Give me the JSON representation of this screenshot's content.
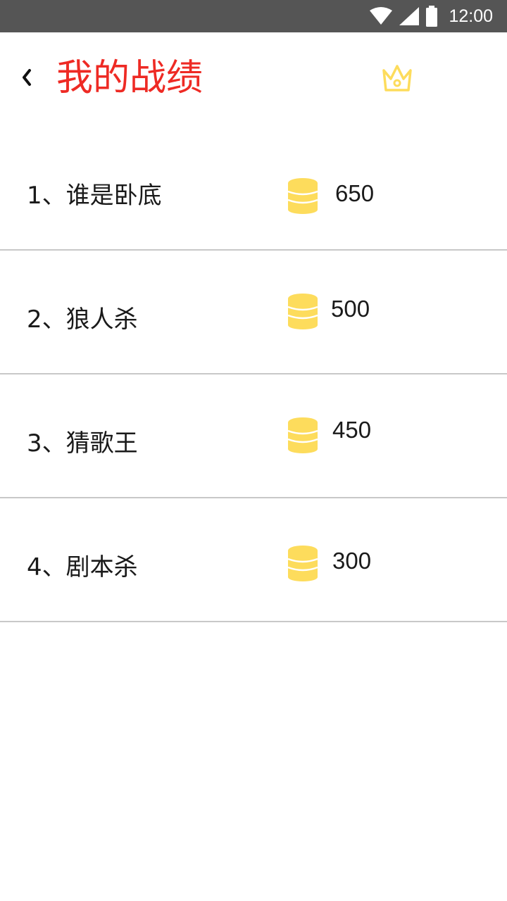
{
  "status_bar": {
    "time": "12:00",
    "icons": [
      "wifi-icon",
      "cellular-signal-icon",
      "battery-icon"
    ]
  },
  "header": {
    "title": "我的战绩",
    "back_icon": "chevron-left-icon",
    "crown_icon": "crown-icon"
  },
  "records": [
    {
      "label": "1、谁是卧底",
      "value": "650"
    },
    {
      "label": "2、狼人杀",
      "value": "500"
    },
    {
      "label": "3、猜歌王",
      "value": "450"
    },
    {
      "label": "4、剧本杀",
      "value": "300"
    }
  ],
  "colors": {
    "title": "#ee2a24",
    "coin": "#fddc5c",
    "status_bar": "#555555",
    "divider": "#c8c8c8"
  }
}
